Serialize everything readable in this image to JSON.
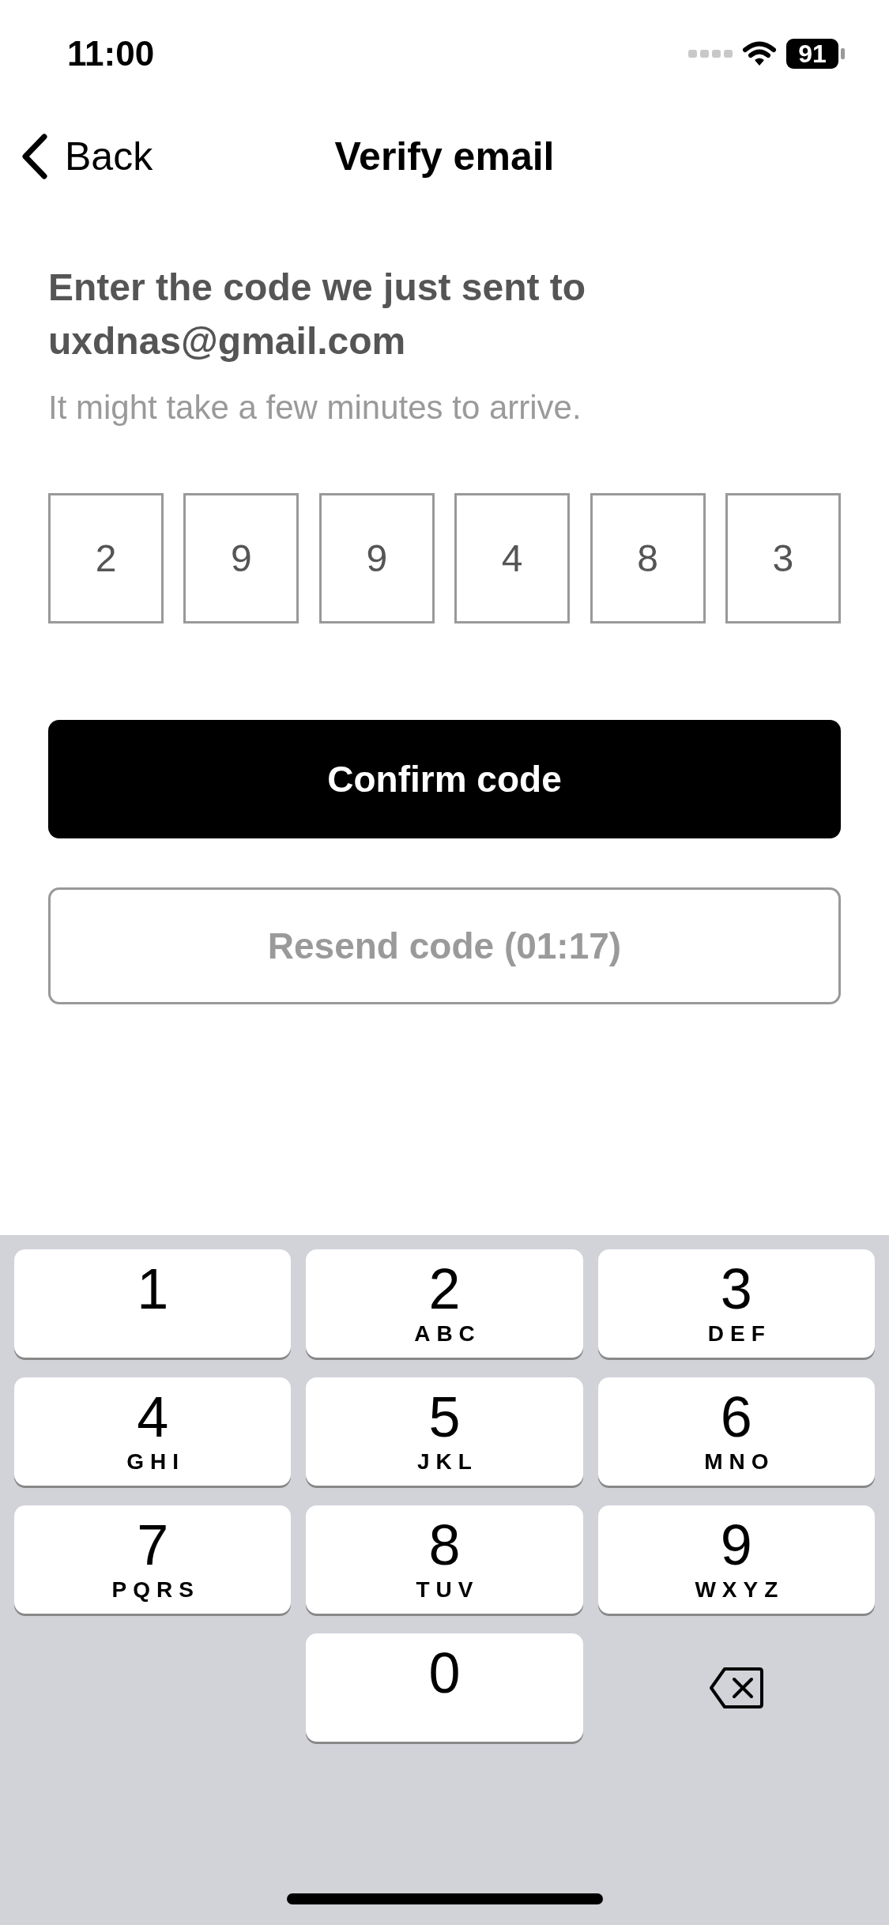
{
  "status_bar": {
    "time": "11:00",
    "battery": "91"
  },
  "nav": {
    "back": "Back",
    "title": "Verify email"
  },
  "heading": "Enter the code we just sent to uxdnas@gmail.com",
  "subtitle": "It might take a few minutes to arrive.",
  "code_digits": [
    "2",
    "9",
    "9",
    "4",
    "8",
    "3"
  ],
  "buttons": [
    {
      "kind": "primary",
      "label": "Confirm code",
      "disabled": false
    },
    {
      "kind": "outline",
      "label": "Resend code (01:17)",
      "disabled": true
    }
  ],
  "keyboard": {
    "keys": [
      {
        "kind": "digit",
        "digit": "1"
      },
      {
        "kind": "digit",
        "digit": "2",
        "letters": "ABC"
      },
      {
        "kind": "digit",
        "digit": "3",
        "letters": "DEF"
      },
      {
        "kind": "digit",
        "digit": "4",
        "letters": "GHI"
      },
      {
        "kind": "digit",
        "digit": "5",
        "letters": "JKL"
      },
      {
        "kind": "digit",
        "digit": "6",
        "letters": "MNO"
      },
      {
        "kind": "digit",
        "digit": "7",
        "letters": "PQRS"
      },
      {
        "kind": "digit",
        "digit": "8",
        "letters": "TUV"
      },
      {
        "kind": "digit",
        "digit": "9",
        "letters": "WXYZ"
      },
      {
        "kind": "digit",
        "digit": "0"
      },
      {
        "kind": "delete"
      }
    ]
  }
}
